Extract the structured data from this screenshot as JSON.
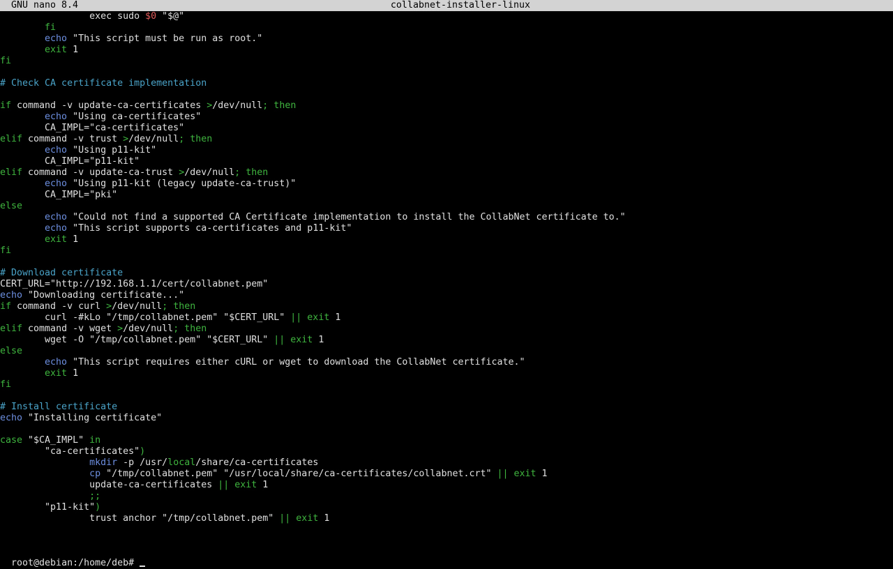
{
  "titlebar": {
    "version": "GNU nano 8.4",
    "filename": "collabnet-installer-linux"
  },
  "colors": {
    "default": "#e0e0e0",
    "keyword": "#3fb53f",
    "builtin": "#6d8fe0",
    "comment": "#4aa3c8",
    "string": "#e0e0e0",
    "variable": "#e05a5a",
    "titlebar_bg": "#d3d3d3"
  },
  "editor": {
    "lines": [
      [
        [
          "d",
          "                exec sudo "
        ],
        [
          "v",
          "$0"
        ],
        [
          "d",
          " \"$@\""
        ]
      ],
      [
        [
          "k",
          "        fi"
        ]
      ],
      [
        [
          "b",
          "        echo"
        ],
        [
          "d",
          " \"This script must be run as root.\""
        ]
      ],
      [
        [
          "k",
          "        exit"
        ],
        [
          "d",
          " 1"
        ]
      ],
      [
        [
          "k",
          "fi"
        ]
      ],
      [],
      [
        [
          "c",
          "# Check CA certificate implementation"
        ]
      ],
      [],
      [
        [
          "k",
          "if"
        ],
        [
          "d",
          " command -v update-ca-certificates "
        ],
        [
          "k",
          ">"
        ],
        [
          "d",
          "/dev/null"
        ],
        [
          "k",
          "; then"
        ]
      ],
      [
        [
          "b",
          "        echo"
        ],
        [
          "d",
          " \"Using ca-certificates\""
        ]
      ],
      [
        [
          "d",
          "        CA_IMPL=\"ca-certificates\""
        ]
      ],
      [
        [
          "k",
          "elif"
        ],
        [
          "d",
          " command -v trust "
        ],
        [
          "k",
          ">"
        ],
        [
          "d",
          "/dev/null"
        ],
        [
          "k",
          "; then"
        ]
      ],
      [
        [
          "b",
          "        echo"
        ],
        [
          "d",
          " \"Using p11-kit\""
        ]
      ],
      [
        [
          "d",
          "        CA_IMPL=\"p11-kit\""
        ]
      ],
      [
        [
          "k",
          "elif"
        ],
        [
          "d",
          " command -v update-ca-trust "
        ],
        [
          "k",
          ">"
        ],
        [
          "d",
          "/dev/null"
        ],
        [
          "k",
          "; then"
        ]
      ],
      [
        [
          "b",
          "        echo"
        ],
        [
          "d",
          " \"Using p11-kit (legacy update-ca-trust)\""
        ]
      ],
      [
        [
          "d",
          "        CA_IMPL=\"pki\""
        ]
      ],
      [
        [
          "k",
          "else"
        ]
      ],
      [
        [
          "b",
          "        echo"
        ],
        [
          "d",
          " \"Could not find a supported CA Certificate implementation to install the CollabNet certificate to.\""
        ]
      ],
      [
        [
          "b",
          "        echo"
        ],
        [
          "d",
          " \"This script supports ca-certificates and p11-kit\""
        ]
      ],
      [
        [
          "k",
          "        exit"
        ],
        [
          "d",
          " 1"
        ]
      ],
      [
        [
          "k",
          "fi"
        ]
      ],
      [],
      [
        [
          "c",
          "# Download certificate"
        ]
      ],
      [
        [
          "d",
          "CERT_URL=\"http://192.168.1.1/cert/collabnet.pem\""
        ]
      ],
      [
        [
          "b",
          "echo"
        ],
        [
          "d",
          " \"Downloading certificate...\""
        ]
      ],
      [
        [
          "k",
          "if"
        ],
        [
          "d",
          " command -v curl "
        ],
        [
          "k",
          ">"
        ],
        [
          "d",
          "/dev/null"
        ],
        [
          "k",
          "; then"
        ]
      ],
      [
        [
          "d",
          "        curl -#kLo \"/tmp/collabnet.pem\" \"$CERT_URL\" "
        ],
        [
          "k",
          "||"
        ],
        [
          "k",
          " exit"
        ],
        [
          "d",
          " 1"
        ]
      ],
      [
        [
          "k",
          "elif"
        ],
        [
          "d",
          " command -v wget "
        ],
        [
          "k",
          ">"
        ],
        [
          "d",
          "/dev/null"
        ],
        [
          "k",
          "; then"
        ]
      ],
      [
        [
          "d",
          "        wget -O \"/tmp/collabnet.pem\" \"$CERT_URL\" "
        ],
        [
          "k",
          "||"
        ],
        [
          "k",
          " exit"
        ],
        [
          "d",
          " 1"
        ]
      ],
      [
        [
          "k",
          "else"
        ]
      ],
      [
        [
          "b",
          "        echo"
        ],
        [
          "d",
          " \"This script requires either cURL or wget to download the CollabNet certificate.\""
        ]
      ],
      [
        [
          "k",
          "        exit"
        ],
        [
          "d",
          " 1"
        ]
      ],
      [
        [
          "k",
          "fi"
        ]
      ],
      [],
      [
        [
          "c",
          "# Install certificate"
        ]
      ],
      [
        [
          "b",
          "echo"
        ],
        [
          "d",
          " \"Installing certificate\""
        ]
      ],
      [],
      [
        [
          "k",
          "case"
        ],
        [
          "d",
          " \"$CA_IMPL\" "
        ],
        [
          "k",
          "in"
        ]
      ],
      [
        [
          "d",
          "        \"ca-certificates\""
        ],
        [
          "k",
          ")"
        ]
      ],
      [
        [
          "b",
          "                mkdir"
        ],
        [
          "d",
          " -p /usr/"
        ],
        [
          "k",
          "local"
        ],
        [
          "d",
          "/share/ca-certificates"
        ]
      ],
      [
        [
          "b",
          "                cp"
        ],
        [
          "d",
          " \"/tmp/collabnet.pem\" \"/usr/local/share/ca-certificates/collabnet.crt\" "
        ],
        [
          "k",
          "||"
        ],
        [
          "k",
          " exit"
        ],
        [
          "d",
          " 1"
        ]
      ],
      [
        [
          "d",
          "                update-ca-certificates "
        ],
        [
          "k",
          "||"
        ],
        [
          "k",
          " exit"
        ],
        [
          "d",
          " 1"
        ]
      ],
      [
        [
          "k",
          "                ;;"
        ]
      ],
      [
        [
          "d",
          "        \"p11-kit\""
        ],
        [
          "k",
          ")"
        ]
      ],
      [
        [
          "d",
          "                trust anchor \"/tmp/collabnet.pem\" "
        ],
        [
          "k",
          "||"
        ],
        [
          "k",
          " exit"
        ],
        [
          "d",
          " 1"
        ]
      ]
    ]
  },
  "terminal": {
    "prompt": "root@debian:/home/deb# "
  }
}
